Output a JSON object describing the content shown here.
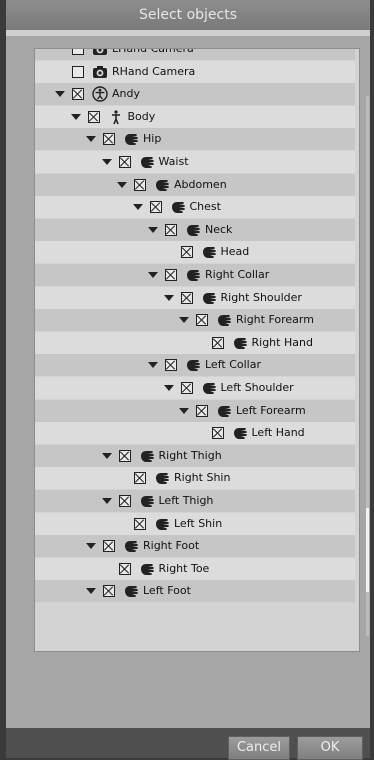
{
  "dialog": {
    "title": "Select objects",
    "buttons": {
      "cancel": "Cancel",
      "ok": "OK"
    }
  },
  "tree": {
    "rows": [
      {
        "label": "LHand Camera",
        "depth": 0,
        "icon": "camera-icon",
        "expanded": false,
        "checked": false
      },
      {
        "label": "RHand Camera",
        "depth": 0,
        "icon": "camera-icon",
        "expanded": false,
        "checked": false
      },
      {
        "label": "Andy",
        "depth": 0,
        "icon": "figure-icon",
        "expanded": true,
        "checked": true
      },
      {
        "label": "Body",
        "depth": 1,
        "icon": "body-icon",
        "expanded": true,
        "checked": true
      },
      {
        "label": "Hip",
        "depth": 2,
        "icon": "hand-icon",
        "expanded": true,
        "checked": true
      },
      {
        "label": "Waist",
        "depth": 3,
        "icon": "hand-icon",
        "expanded": true,
        "checked": true
      },
      {
        "label": "Abdomen",
        "depth": 4,
        "icon": "hand-icon",
        "expanded": true,
        "checked": true
      },
      {
        "label": "Chest",
        "depth": 5,
        "icon": "hand-icon",
        "expanded": true,
        "checked": true
      },
      {
        "label": "Neck",
        "depth": 6,
        "icon": "hand-icon",
        "expanded": true,
        "checked": true
      },
      {
        "label": "Head",
        "depth": 7,
        "icon": "hand-icon",
        "expanded": false,
        "checked": true
      },
      {
        "label": "Right Collar",
        "depth": 6,
        "icon": "hand-icon",
        "expanded": true,
        "checked": true
      },
      {
        "label": "Right Shoulder",
        "depth": 7,
        "icon": "hand-icon",
        "expanded": true,
        "checked": true
      },
      {
        "label": "Right Forearm",
        "depth": 8,
        "icon": "hand-icon",
        "expanded": true,
        "checked": true
      },
      {
        "label": "Right Hand",
        "depth": 9,
        "icon": "hand-icon",
        "expanded": false,
        "checked": true
      },
      {
        "label": "Left Collar",
        "depth": 6,
        "icon": "hand-icon",
        "expanded": true,
        "checked": true
      },
      {
        "label": "Left Shoulder",
        "depth": 7,
        "icon": "hand-icon",
        "expanded": true,
        "checked": true
      },
      {
        "label": "Left Forearm",
        "depth": 8,
        "icon": "hand-icon",
        "expanded": true,
        "checked": true
      },
      {
        "label": "Left Hand",
        "depth": 9,
        "icon": "hand-icon",
        "expanded": false,
        "checked": true
      },
      {
        "label": "Right Thigh",
        "depth": 3,
        "icon": "hand-icon",
        "expanded": true,
        "checked": true
      },
      {
        "label": "Right Shin",
        "depth": 4,
        "icon": "hand-icon",
        "expanded": false,
        "checked": true
      },
      {
        "label": "Left Thigh",
        "depth": 3,
        "icon": "hand-icon",
        "expanded": true,
        "checked": true
      },
      {
        "label": "Left Shin",
        "depth": 4,
        "icon": "hand-icon",
        "expanded": false,
        "checked": true
      },
      {
        "label": "Right Foot",
        "depth": 2,
        "icon": "hand-icon",
        "expanded": true,
        "checked": true
      },
      {
        "label": "Right Toe",
        "depth": 3,
        "icon": "hand-icon",
        "expanded": false,
        "checked": true
      },
      {
        "label": "Left Foot",
        "depth": 2,
        "icon": "hand-icon",
        "expanded": true,
        "checked": true
      }
    ]
  }
}
